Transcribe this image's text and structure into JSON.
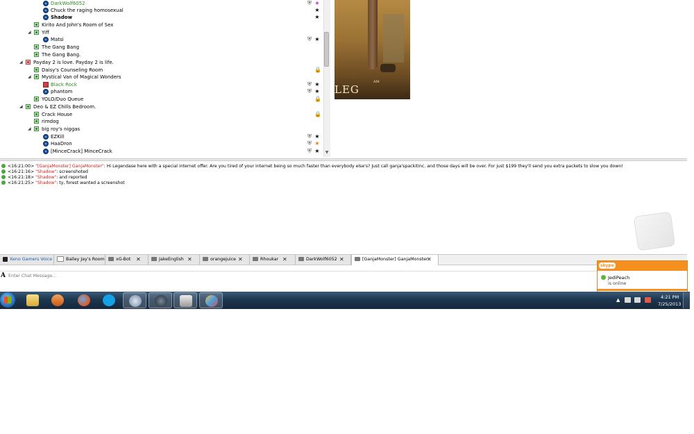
{
  "tree": {
    "rows": [
      {
        "label": "DarkWolf6052",
        "green": true,
        "shield": true,
        "star": "pink"
      },
      {
        "label": "Chuck the raging homosexual",
        "star": "black"
      },
      {
        "label": "Shadow",
        "bold": true,
        "star": "black"
      },
      {
        "label": "Kirito And John's Room of Sex"
      },
      {
        "label": "Yiff"
      },
      {
        "label": "Matsi",
        "shield": true,
        "star": "black"
      },
      {
        "label": "The Gang Bang"
      },
      {
        "label": "The Gang Bang."
      },
      {
        "label": "Payday 2 is love. Payday 2 is life."
      },
      {
        "label": "Daisy's Counseling Room",
        "lock": true
      },
      {
        "label": "Mystical Van of Magical Wonders"
      },
      {
        "label": "Black Rock",
        "green": true,
        "shield": true,
        "star": "black"
      },
      {
        "label": "phantom",
        "shield": true,
        "star": "black"
      },
      {
        "label": "YOLO/Duo Queue",
        "lock": true
      },
      {
        "label": "Deo & EZ Chills Bedroom."
      },
      {
        "label": "Crack House",
        "lock": true
      },
      {
        "label": "rimdog"
      },
      {
        "label": "big roy's niggas"
      },
      {
        "label": "EZKill",
        "shield": true,
        "star": "black"
      },
      {
        "label": "HaaDron",
        "shield": true,
        "star": "orange"
      },
      {
        "label": "[MinceCrack] MinceCrack",
        "shield": true,
        "star": "black"
      }
    ]
  },
  "poster": {
    "title": "LEG",
    "subtitle": "AM"
  },
  "chat": {
    "messages": [
      {
        "time": "<16:21:00>",
        "nick": "\"[GanjaMonster] GanjaMonster\"",
        "text": ": Hi Legendase here with a special internet offer. Are you tired of your internet being so much faster than everybody else's? Just call ganja'spackitinc. and those days will be over. For just $199 they'll send you extra packets to slow you down!"
      },
      {
        "time": "<16:21:16>",
        "nick": "\"Shadow\"",
        "text": ": screenshoted"
      },
      {
        "time": "<16:21:18>",
        "nick": "\"Shadow\"",
        "text": ": and reported"
      },
      {
        "time": "<16:21:25>",
        "nick": "\"Shadow\"",
        "text": ": ty, forest wanted a screenshot"
      }
    ]
  },
  "tabs": [
    {
      "label": "Xeno Gamers Voice"
    },
    {
      "label": "Bailey Jay's Room"
    },
    {
      "label": "xG-Bot",
      "closable": true
    },
    {
      "label": "JakeEnglish",
      "closable": true
    },
    {
      "label": "orangejuice",
      "closable": true
    },
    {
      "label": "Rhoukar",
      "closable": true
    },
    {
      "label": "DarkWolf6052",
      "closable": true
    },
    {
      "label": "[GanjaMonster] GanjaMonster",
      "closable": true,
      "active": true
    }
  ],
  "close_glyph": "✕",
  "input": {
    "placeholder": "Enter Chat Message...",
    "icon": "A"
  },
  "toast": {
    "brand": "skype",
    "name": "JediPeach",
    "status": "is online"
  },
  "taskbar": {
    "time": "4:21 PM",
    "date": "7/25/2013",
    "tray_caret": "▲"
  },
  "colors": {
    "nick": "#d41b1b",
    "green_user": "#2e8b1f",
    "skype_orange": "#f5901e",
    "taskbar": "#1d3650"
  }
}
